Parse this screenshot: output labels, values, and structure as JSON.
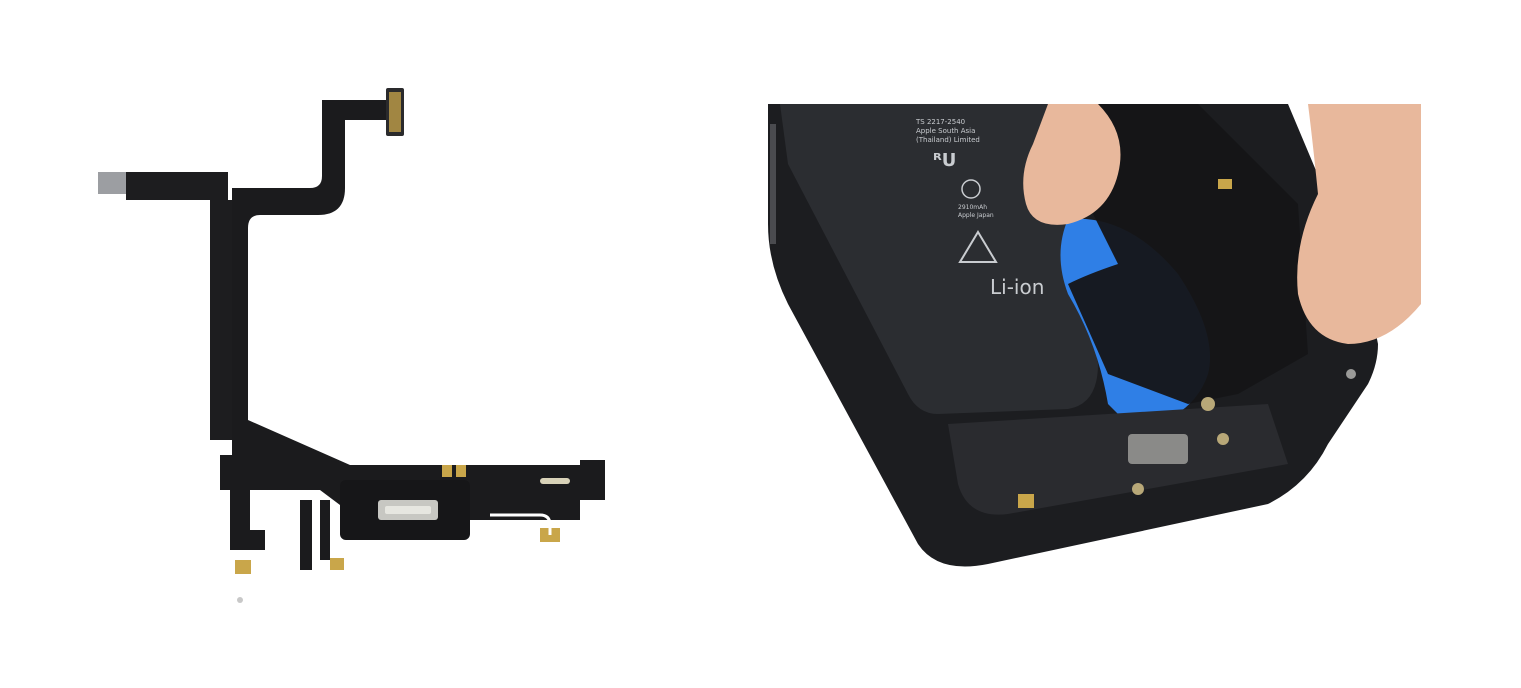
{
  "left_photo": {
    "subject": "charging-port-flex-cable",
    "colors": {
      "cable": "#1a1a1c",
      "connector_gold": "#c9a64a",
      "background": "#ffffff"
    }
  },
  "right_photo": {
    "subject": "phone-interior-pry-tool",
    "battery_label": {
      "line1": "Li-ion",
      "small_line1": "TS 2217-2540",
      "small_line2": "Apple South Asia",
      "small_line3": "(Thailand) Limited",
      "small_line4": "2910mAh",
      "small_line5": "Apple Japan"
    },
    "colors": {
      "battery": "#2b2d31",
      "pry_tool": "#2f7fe6",
      "skin": "#e8b89c",
      "frame": "#1c1d20"
    }
  }
}
